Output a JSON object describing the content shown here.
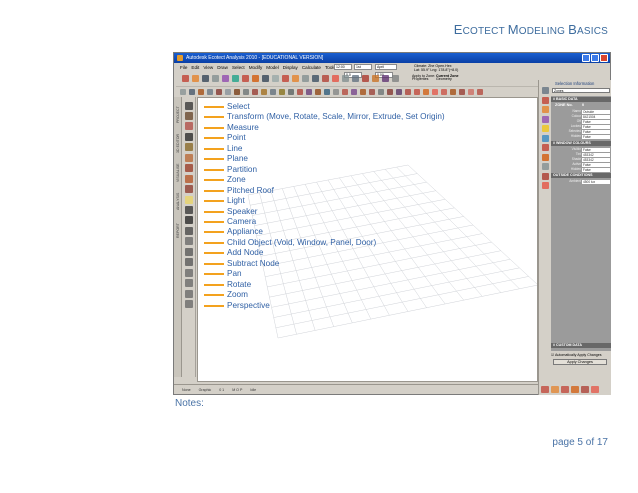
{
  "header": {
    "title_first": "E",
    "title_rest": "COTECT ",
    "title_second_first": "M",
    "title_second_rest": "ODELING ",
    "title_third_first": "B",
    "title_third_rest": "ASICS"
  },
  "app": {
    "title": "Autodesk Ecotect Analysis 2010 - [EDUCATIONAL VERSION]",
    "menu": [
      "File",
      "Edit",
      "View",
      "Draw",
      "Select",
      "Modify",
      "Model",
      "Display",
      "Calculate",
      "Tools",
      "Help"
    ],
    "time_value": "12:00",
    "date_value": "1st",
    "month_value": "April",
    "climate_line1": "Climate: Zhe Open.Hex",
    "climate_line2": "Lat: 55.9°  Lng: 178.8°(+8.0)",
    "layer_value": "0.0",
    "zone_value": "0.00",
    "apply_to_line1": "Apply to Zone:",
    "apply_to_line2": "Properties",
    "current_zone_line1": "Current Zone",
    "current_zone_line2": "Geometry",
    "side_tabs": [
      "PROJECT",
      "3D EDITOR",
      "VISUALISE",
      "ANALYSIS",
      "REPORT"
    ],
    "status": [
      "None",
      "Graphic",
      "0  1",
      "M  O  P",
      "Idle"
    ]
  },
  "tools": [
    {
      "label": "Select",
      "color": "#3a3a3a"
    },
    {
      "label": "Transform (Move, Rotate, Scale, Mirror, Extrude, Set Origin)",
      "color": "#6a4a30"
    },
    {
      "label": "Measure",
      "color": "#b0504a"
    },
    {
      "label": "Point",
      "color": "#2d2d2d"
    },
    {
      "label": "Line",
      "color": "#8a6a2a"
    },
    {
      "label": "Plane",
      "color": "#b86a3a"
    },
    {
      "label": "Partition",
      "color": "#9a3e2a"
    },
    {
      "label": "Zone",
      "color": "#b4572a"
    },
    {
      "label": "Pitched Roof",
      "color": "#8e3e32"
    },
    {
      "label": "Light",
      "color": "#e9d56a"
    },
    {
      "label": "Speaker",
      "color": "#3a3a3a"
    },
    {
      "label": "Camera",
      "color": "#2a2a2a"
    },
    {
      "label": "Appliance",
      "color": "#4a4a4a"
    },
    {
      "label": "Child Object (Void, Window, Panel, Door)",
      "color": "#6a6a6a"
    },
    {
      "label": "Add Node",
      "color": "#5a5a5a"
    },
    {
      "label": "Subtract Node",
      "color": "#5a5a5a"
    },
    {
      "label": "Pan",
      "color": "#6a6a6a"
    },
    {
      "label": "Rotate",
      "color": "#6a6a6a"
    },
    {
      "label": "Zoom",
      "color": "#6a6a6a"
    },
    {
      "label": "Perspective",
      "color": "#6a6a6a"
    }
  ],
  "panel": {
    "title": "Selection Information",
    "dropdown": "Zones",
    "basic_head": "# BASIC DATA",
    "zone_no_key": "ZONE No.",
    "zone_no_value": "0",
    "basic_rows": [
      {
        "key": "Name",
        "value": "Outside"
      },
      {
        "key": "Colour",
        "value": "8421504"
      },
      {
        "key": "Off",
        "value": "False"
      },
      {
        "key": "Locked",
        "value": "False"
      },
      {
        "key": "Selected",
        "value": "False"
      },
      {
        "key": "Hidden",
        "value": "False"
      }
    ],
    "thermal_head": "# WINDOW COLOURS",
    "thermal_rows": [
      {
        "key": "Visible",
        "value": "False"
      },
      {
        "key": "Tint",
        "value": "453342"
      },
      {
        "key": "Shade",
        "value": "453342"
      },
      {
        "key": "Active",
        "value": "False"
      },
      {
        "key": "Hidden",
        "value": "False"
      }
    ],
    "outside_head": "OUTSIDE CONDITIONS",
    "outside_rows": [
      {
        "key": "Ambient",
        "value": "4500 lux"
      }
    ],
    "custom_head": "# CUSTOM DATA",
    "auto_apply": "Automatically Apply Changes",
    "apply_btn": "Apply Changes"
  },
  "notes": "Notes:",
  "page_number": "page  5 of 17",
  "colors": {
    "accent_blue": "#3161a5",
    "leader_orange": "#f3a21e",
    "panel_gray": "#9b9b9b"
  }
}
